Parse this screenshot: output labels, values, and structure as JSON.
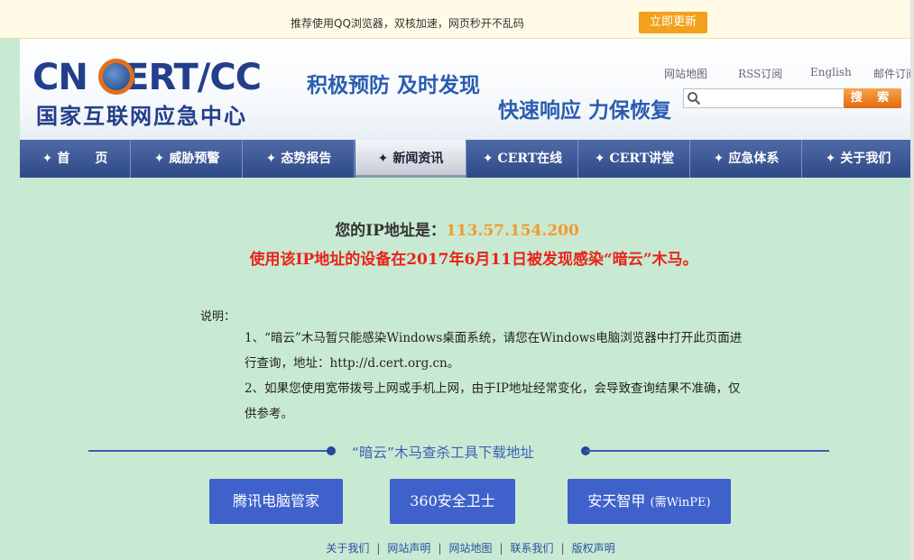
{
  "topbar": {
    "text": "推荐使用QQ浏览器，双核加速，网页秒开不乱码",
    "update_button": "立即更新"
  },
  "header": {
    "logo_main": "CN CERT/CC",
    "logo_sub": "国家互联网应急中心",
    "slogan1": "积极预防 及时发现",
    "slogan2": "快速响应 力保恢复",
    "links": [
      "网站地图",
      "RSS订阅",
      "English",
      "邮件订阅"
    ],
    "search_button": "搜 索",
    "search_placeholder": ""
  },
  "nav": {
    "items": [
      {
        "label": "首　　页"
      },
      {
        "label": "威胁预警"
      },
      {
        "label": "态势报告"
      },
      {
        "label": "新闻资讯"
      },
      {
        "label": "CERT在线"
      },
      {
        "label": "CERT讲堂"
      },
      {
        "label": "应急体系"
      },
      {
        "label": "关于我们"
      }
    ],
    "active_index": 3,
    "star": "✦"
  },
  "main": {
    "ip_label": "您的IP地址是：",
    "ip_value": "113.57.154.200",
    "warning": "使用该IP地址的设备在2017年6月11日被发现感染“暗云”木马。",
    "desc_title": "说明：",
    "desc_items": [
      "1、“暗云”木马暂只能感染Windows桌面系统，请您在Windows电脑浏览器中打开此页面进行查询，地址：http://d.cert.org.cn。",
      "2、如果您使用宽带拨号上网或手机上网，由于IP地址经常变化，会导致查询结果不准确，仅供参考。"
    ],
    "tools_title": "“暗云”木马查杀工具下载地址",
    "tools": [
      {
        "label": "腾讯电脑管家",
        "note": ""
      },
      {
        "label": "360安全卫士",
        "note": ""
      },
      {
        "label": "安天智甲 ",
        "note": "(需WinPE)"
      }
    ]
  },
  "footer": {
    "links": [
      "关于我们",
      "网站声明",
      "网站地图",
      "联系我们",
      "版权声明"
    ],
    "separator": "|"
  },
  "colors": {
    "background": "#c9ead2",
    "nav": "#2e4a86",
    "ip_value": "#f39a2e",
    "warning": "#e8231b",
    "tool_button": "#3e61cc",
    "update_button": "#f3a11d"
  }
}
